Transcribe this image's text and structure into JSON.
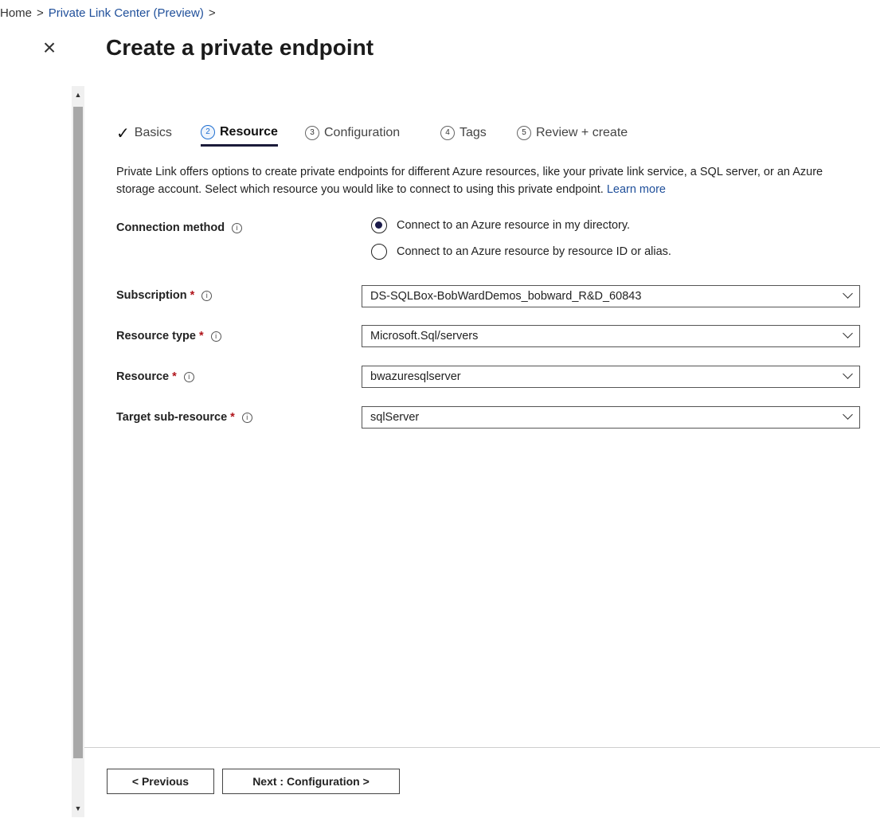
{
  "breadcrumb": {
    "home": "Home",
    "sep1": ">",
    "private_link": "Private Link Center (Preview)",
    "sep2": ">"
  },
  "close_icon": "×",
  "page_title": "Create a private endpoint",
  "scrollbar": {
    "up": "▲",
    "down": "▼"
  },
  "tabs": [
    {
      "label": "Basics",
      "state": "completed",
      "icon": "✓"
    },
    {
      "num": "2",
      "label": "Resource",
      "state": "active"
    },
    {
      "num": "3",
      "label": "Configuration",
      "state": "pending"
    },
    {
      "num": "4",
      "label": "Tags",
      "state": "pending"
    },
    {
      "num": "5",
      "label": "Review + create",
      "state": "pending"
    }
  ],
  "description": {
    "text": "Private Link offers options to create private endpoints for different Azure resources, like your private link service, a SQL server, or an Azure storage account. Select which resource you would like to connect to using this private endpoint.",
    "learn_more": "Learn more"
  },
  "form": {
    "connection_method": {
      "label": "Connection method",
      "info": "i",
      "options": [
        {
          "label": "Connect to an Azure resource in my directory.",
          "checked": true
        },
        {
          "label": "Connect to an Azure resource by resource ID or alias.",
          "checked": false
        }
      ]
    },
    "subscription": {
      "label": "Subscription",
      "required": "*",
      "info": "i",
      "value": "DS-SQLBox-BobWardDemos_bobward_R&D_60843"
    },
    "resource_type": {
      "label": "Resource type",
      "required": "*",
      "info": "i",
      "value": "Microsoft.Sql/servers"
    },
    "resource": {
      "label": "Resource",
      "required": "*",
      "info": "i",
      "value": "bwazuresqlserver"
    },
    "target_sub_resource": {
      "label": "Target sub-resource",
      "required": "*",
      "info": "i",
      "value": "sqlServer"
    }
  },
  "footer": {
    "previous": "< Previous",
    "next": "Next : Configuration >"
  },
  "colors": {
    "accent": "#1f6fd1",
    "link": "#1f4f9a",
    "required": "#b0141b"
  }
}
